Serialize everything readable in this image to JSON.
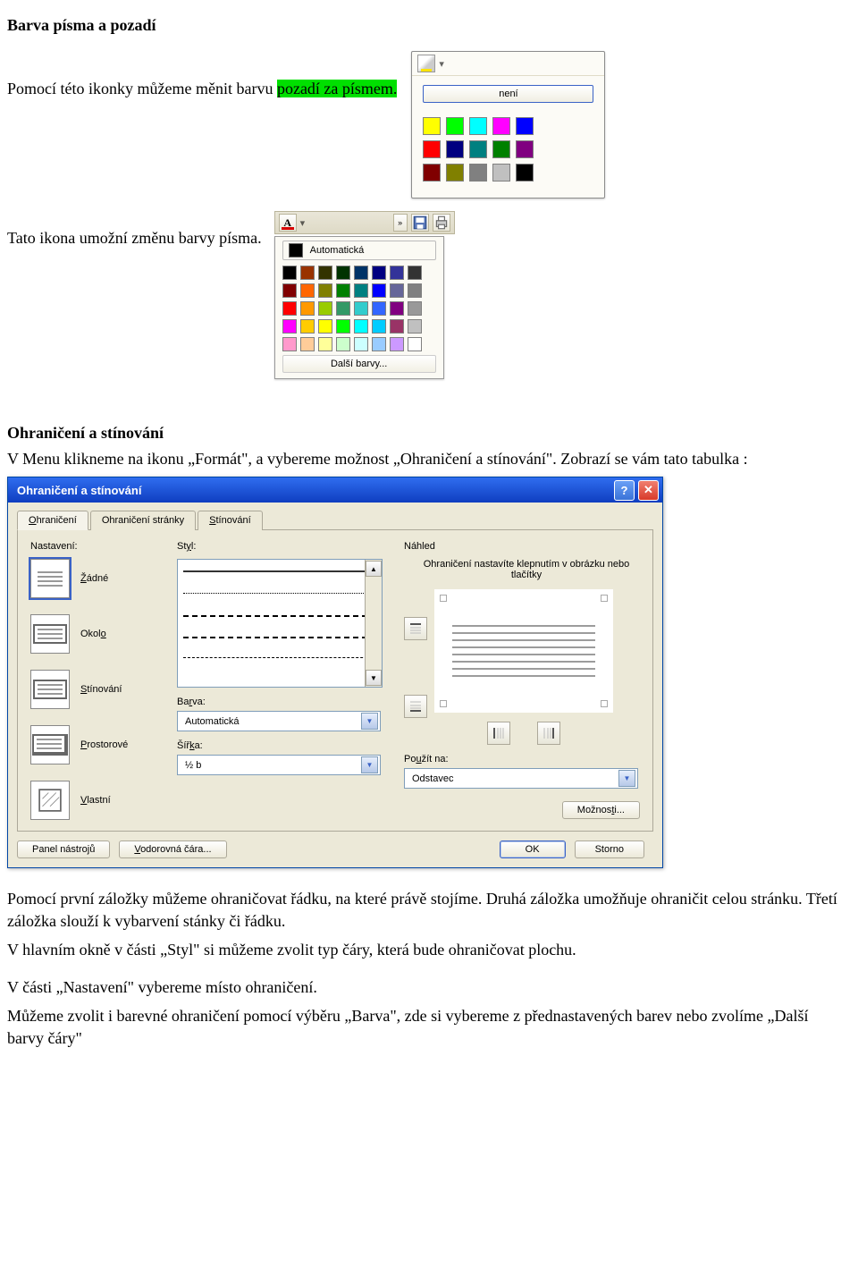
{
  "headings": {
    "h1": "Barva písma a pozadí",
    "h2": "Ohraničení a stínování"
  },
  "paras": {
    "p1a": "Pomocí této ikonky můžeme měnit barvu ",
    "p1_hl": "pozadí za písmem.",
    "p2": "Tato ikona umožní změnu barvy písma.",
    "p3": "V Menu klikneme na ikonu „Formát\", a vybereme možnost „Ohraničení a stínování\". Zobrazí se vám tato tabulka :",
    "p4": "Pomocí první záložky můžeme ohraničovat řádku, na které právě stojíme. Druhá záložka umožňuje ohraničit celou stránku. Třetí záložka slouží k vybarvení stánky či řádku.",
    "p5": "V hlavním okně v části „Styl\" si můžeme zvolit typ čáry, která bude ohraničovat plochu.",
    "p6": "V části „Nastavení\"  vybereme místo ohraničení.",
    "p7": "Můžeme zvolit i barevné ohraničení pomocí výběru „Barva\", zde si vybereme z přednastavených barev nebo zvolíme „Další barvy čáry\""
  },
  "hl_palette": {
    "none_label": "není",
    "rows": [
      [
        "#ffff00",
        "#00ff00",
        "#00ffff",
        "#ff00ff",
        "#0000ff"
      ],
      [
        "#ff0000",
        "#000080",
        "#008080",
        "#008000",
        "#800080"
      ],
      [
        "#800000",
        "#808000",
        "#808080",
        "#c0c0c0",
        "#000000"
      ]
    ]
  },
  "fc_palette": {
    "auto_label": "Automatická",
    "more_label": "Další barvy...",
    "rows": [
      [
        "#000000",
        "#993300",
        "#333300",
        "#003300",
        "#003366",
        "#000080",
        "#333399",
        "#333333"
      ],
      [
        "#800000",
        "#ff6600",
        "#808000",
        "#008000",
        "#008080",
        "#0000ff",
        "#666699",
        "#808080"
      ],
      [
        "#ff0000",
        "#ff9900",
        "#99cc00",
        "#339966",
        "#33cccc",
        "#3366ff",
        "#800080",
        "#999999"
      ],
      [
        "#ff00ff",
        "#ffcc00",
        "#ffff00",
        "#00ff00",
        "#00ffff",
        "#00ccff",
        "#993366",
        "#c0c0c0"
      ],
      [
        "#ff99cc",
        "#ffcc99",
        "#ffff99",
        "#ccffcc",
        "#ccffff",
        "#99ccff",
        "#cc99ff",
        "#ffffff"
      ]
    ]
  },
  "dialog": {
    "title": "Ohraničení a stínování",
    "tabs": {
      "t1_accel": "O",
      "t1_rest": "hraničení",
      "t2": "Ohraničení stránky",
      "t3_accel": "S",
      "t3_rest": "tínování"
    },
    "nastaveni": {
      "label": "Nastavení:",
      "items": {
        "none_accel": "Ž",
        "none_rest": "ádné",
        "okolo": "Okol",
        "okolo_accel": "o",
        "stin_accel": "S",
        "stin_rest": "tínování",
        "prost_accel": "P",
        "prost_rest": "rostorové",
        "vlast_accel": "V",
        "vlast_rest": "lastní"
      }
    },
    "styl": {
      "label_accel": "y",
      "label_pre": "St",
      "label_post": "l:",
      "barva_label": "Ba",
      "barva_accel": "r",
      "barva_post": "va:",
      "barva_value": "Automatická",
      "sirka_label": "Šíř",
      "sirka_accel": "k",
      "sirka_post": "a:",
      "sirka_value": "½ b"
    },
    "nahled": {
      "label": "Náhled",
      "hint": "Ohraničení nastavíte klepnutím v obrázku nebo tlačítky",
      "pouzit_label": "Po",
      "pouzit_accel": "u",
      "pouzit_post": "žít na:",
      "pouzit_value": "Odstavec",
      "moznosti": "Možnos",
      "moznosti_accel": "t",
      "moznosti_post": "i..."
    },
    "footer": {
      "panel": "Panel nástrojů",
      "vodo_accel": "V",
      "vodo_rest": "odorovná čára...",
      "ok": "OK",
      "storno": "Storno"
    }
  }
}
